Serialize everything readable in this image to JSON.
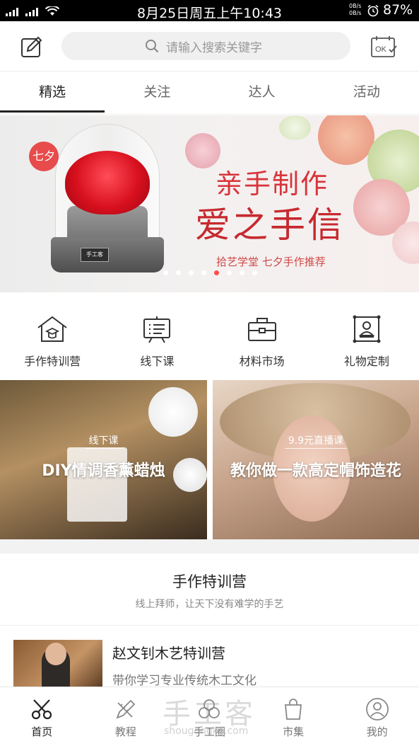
{
  "status_bar": {
    "time": "8月25日周五上午10:43",
    "net_up": "0B/s",
    "net_down": "0B/s",
    "battery": "87%"
  },
  "header": {
    "edit_icon": "edit-icon",
    "search_placeholder": "请输入搜索关键字",
    "checkin_icon": "calendar-ok-icon",
    "checkin_text": "OK"
  },
  "tabs": [
    {
      "label": "精选",
      "active": true
    },
    {
      "label": "关注",
      "active": false
    },
    {
      "label": "达人",
      "active": false
    },
    {
      "label": "活动",
      "active": false
    }
  ],
  "banner": {
    "badge": "七夕",
    "title_line1": "亲手制作",
    "title_line2": "爱之手信",
    "subtitle": "拾艺学堂  七夕手作推荐",
    "product_plaque": "手工客",
    "slide_count": 8,
    "active_slide": 5
  },
  "categories": [
    {
      "label": "手作特训营",
      "icon": "school-house-icon"
    },
    {
      "label": "线下课",
      "icon": "board-icon"
    },
    {
      "label": "材料市场",
      "icon": "toolbox-icon"
    },
    {
      "label": "礼物定制",
      "icon": "gift-card-icon"
    }
  ],
  "cards": [
    {
      "tag": "线下课",
      "title": "DIY情调香薰蜡烛"
    },
    {
      "tag": "9.9元直播课",
      "title": "教你做一款高定帽饰造花"
    }
  ],
  "section": {
    "title": "手作特训营",
    "subtitle": "线上拜师，让天下没有难学的手艺"
  },
  "camp": {
    "title": "赵文钊木艺特训营",
    "description": "带你学习专业传统木工文化"
  },
  "bottom_nav": [
    {
      "label": "首页",
      "icon": "scissors-icon",
      "active": true
    },
    {
      "label": "教程",
      "icon": "pencil-ruler-icon",
      "active": false
    },
    {
      "label": "手工圈",
      "icon": "circle-community-icon",
      "active": false
    },
    {
      "label": "市集",
      "icon": "shopping-bag-icon",
      "active": false
    },
    {
      "label": "我的",
      "icon": "user-icon",
      "active": false
    }
  ],
  "watermark": {
    "text": "手工客",
    "url": "shougongke.com"
  },
  "colors": {
    "accent": "#d8343b",
    "dot_active": "#ff4d4f",
    "search_bg": "#f0f0f0"
  }
}
